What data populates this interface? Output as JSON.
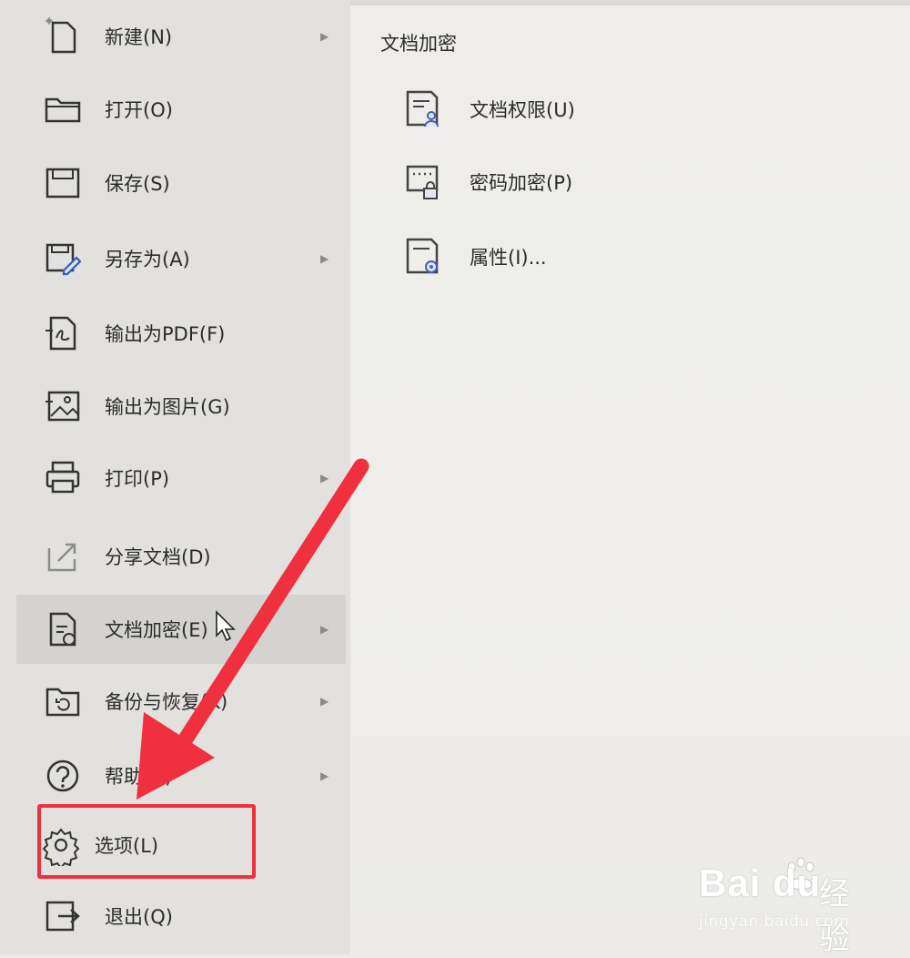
{
  "menu": {
    "items": [
      {
        "label": "新建(N)",
        "icon": "new-document-icon",
        "submenu": true
      },
      {
        "label": "打开(O)",
        "icon": "folder-open-icon",
        "submenu": false
      },
      {
        "label": "保存(S)",
        "icon": "save-icon",
        "submenu": false
      },
      {
        "label": "另存为(A)",
        "icon": "save-as-icon",
        "submenu": true
      },
      {
        "label": "输出为PDF(F)",
        "icon": "export-pdf-icon",
        "submenu": false
      },
      {
        "label": "输出为图片(G)",
        "icon": "export-image-icon",
        "submenu": false
      },
      {
        "label": "打印(P)",
        "icon": "printer-icon",
        "submenu": true
      },
      {
        "label": "分享文档(D)",
        "icon": "share-icon",
        "submenu": false
      },
      {
        "label": "文档加密(E)",
        "icon": "document-lock-icon",
        "submenu": true,
        "active": true
      },
      {
        "label": "备份与恢复(K)",
        "icon": "backup-restore-icon",
        "submenu": true
      },
      {
        "label": "帮助(H)",
        "icon": "help-icon",
        "submenu": true
      },
      {
        "label": "选项(L)",
        "icon": "gear-icon",
        "submenu": false
      },
      {
        "label": "退出(Q)",
        "icon": "exit-icon",
        "submenu": false
      }
    ]
  },
  "submenu": {
    "title": "文档加密",
    "items": [
      {
        "label": "文档权限(U)",
        "icon": "document-permission-icon"
      },
      {
        "label": "密码加密(P)",
        "icon": "password-lock-icon"
      },
      {
        "label": "属性(I)...",
        "icon": "document-properties-icon"
      }
    ]
  },
  "annotation": {
    "highlight_color": "#f0303f",
    "arrow_color": "#f0303f"
  },
  "watermark": {
    "logo": "Bai du",
    "cn": "经验",
    "url": "jingyan.baidu.com"
  }
}
